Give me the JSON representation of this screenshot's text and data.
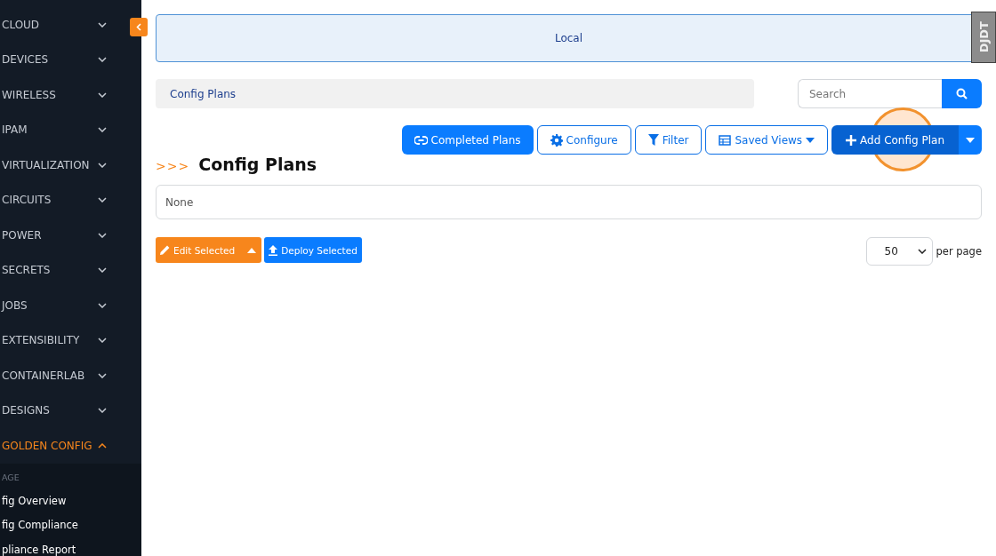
{
  "sidebar": {
    "items": [
      {
        "label": "CLOUD",
        "expanded": false
      },
      {
        "label": "DEVICES",
        "expanded": false
      },
      {
        "label": "WIRELESS",
        "expanded": false
      },
      {
        "label": "IPAM",
        "expanded": false
      },
      {
        "label": "VIRTUALIZATION",
        "expanded": false
      },
      {
        "label": "CIRCUITS",
        "expanded": false
      },
      {
        "label": "POWER",
        "expanded": false
      },
      {
        "label": "SECRETS",
        "expanded": false
      },
      {
        "label": "JOBS",
        "expanded": false
      },
      {
        "label": "EXTENSIBILITY",
        "expanded": false
      },
      {
        "label": "CONTAINERLAB",
        "expanded": false
      },
      {
        "label": "DESIGNS",
        "expanded": false
      },
      {
        "label": "GOLDEN CONFIG",
        "expanded": true,
        "children": [
          {
            "kind": "heading",
            "label": "AGE"
          },
          {
            "kind": "link",
            "label": "fig Overview"
          },
          {
            "kind": "link",
            "label": "fig Compliance"
          },
          {
            "kind": "link",
            "label": "pliance Report"
          }
        ]
      }
    ]
  },
  "banner": {
    "text": "Local"
  },
  "breadcrumb": {
    "text": "Config Plans"
  },
  "search": {
    "placeholder": "Search"
  },
  "toolbar": [
    {
      "kind": "completed",
      "label": "Completed Plans"
    },
    {
      "kind": "configure",
      "label": "Configure"
    },
    {
      "kind": "filter",
      "label": "Filter"
    },
    {
      "kind": "views",
      "label": "Saved Views"
    },
    {
      "kind": "add",
      "label": "Add Config Plan"
    }
  ],
  "title": {
    "prefix": ">>>",
    "text": "Config Plans"
  },
  "filter_box": {
    "text": "None"
  },
  "actions": [
    {
      "kind": "edit",
      "label": "Edit Selected"
    },
    {
      "kind": "deploy",
      "label": "Deploy Selected"
    }
  ],
  "pagination": {
    "value": "50",
    "label": "per page"
  },
  "debug_handle": {
    "text": "DJDT"
  }
}
